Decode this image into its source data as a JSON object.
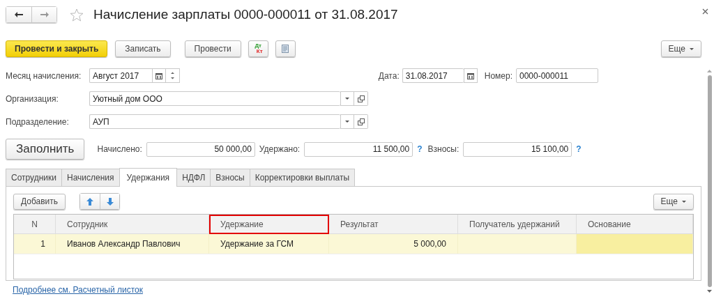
{
  "window": {
    "title": "Начисление зарплаты 0000-000011 от 31.08.2017"
  },
  "toolbar": {
    "buttons": [
      {
        "label": "Провести и закрыть",
        "kind": "primary"
      },
      {
        "label": "Записать",
        "kind": "normal"
      },
      {
        "label": "Провести",
        "kind": "normal"
      }
    ],
    "dt_kt": {
      "debit": "Дт",
      "credit": "Кт"
    },
    "more": "Еще"
  },
  "header": {
    "month": {
      "label": "Месяц начисления:",
      "value": "Август 2017"
    },
    "date": {
      "label": "Дата:",
      "value": "31.08.2017"
    },
    "number": {
      "label": "Номер:",
      "value": "0000-000011"
    },
    "organization": {
      "label": "Организация:",
      "value": "Уютный дом ООО"
    },
    "subdivision": {
      "label": "Подразделение:",
      "value": "АУП"
    }
  },
  "totals": {
    "fill_button": "Заполнить",
    "items": [
      {
        "label": "Начислено:",
        "value": "50 000,00"
      },
      {
        "label": "Удержано:",
        "value": "11 500,00",
        "help": "?"
      },
      {
        "label": "Взносы:",
        "value": "15 100,00",
        "help": "?"
      }
    ]
  },
  "tabs": [
    {
      "label": "Сотрудники",
      "selected": false
    },
    {
      "label": "Начисления",
      "selected": false
    },
    {
      "label": "Удержания",
      "selected": true
    },
    {
      "label": "НДФЛ",
      "selected": false
    },
    {
      "label": "Взносы",
      "selected": false
    },
    {
      "label": "Корректировки выплаты",
      "selected": false
    }
  ],
  "table_toolbar": {
    "add": "Добавить",
    "more": "Еще"
  },
  "table": {
    "columns": [
      {
        "label": "N",
        "highlighted": false
      },
      {
        "label": "Сотрудник",
        "highlighted": false
      },
      {
        "label": "Удержание",
        "highlighted": true
      },
      {
        "label": "Результат",
        "highlighted": false
      },
      {
        "label": "Получатель удержаний",
        "highlighted": false
      },
      {
        "label": "Основание",
        "highlighted": false
      }
    ],
    "rows": [
      {
        "selected": true,
        "cells": [
          {
            "text": "1"
          },
          {
            "text": "Иванов Александр Павлович"
          },
          {
            "text": "Удержание за ГСМ"
          },
          {
            "text": "5 000,00"
          },
          {},
          {
            "focused": true
          }
        ]
      }
    ]
  },
  "footer_link": "Подробнее см. Расчетный листок"
}
